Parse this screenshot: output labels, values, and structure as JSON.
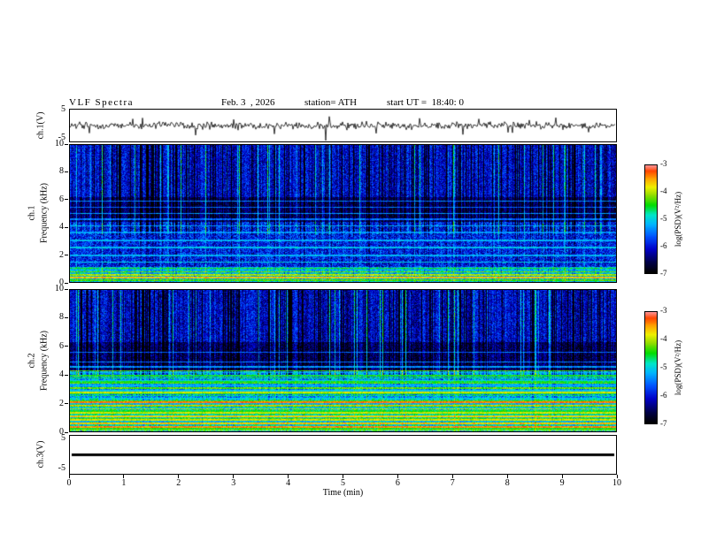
{
  "header": {
    "title": "VLF Spectra",
    "date": "Feb. 3  , 2026",
    "station": "station= ATH",
    "start_ut": "start UT =  18:40: 0"
  },
  "axes": {
    "x": {
      "label": "Time (min)",
      "ticks": [
        0,
        1,
        2,
        3,
        4,
        5,
        6,
        7,
        8,
        9,
        10
      ],
      "range": [
        0,
        10
      ]
    },
    "freq": {
      "ticks": [
        10,
        8,
        6,
        4,
        2,
        0
      ],
      "range": [
        0,
        10
      ]
    },
    "volt": {
      "top": "5",
      "bottom": "-5",
      "range": [
        -5,
        5
      ]
    }
  },
  "panels": {
    "ch1_wave": {
      "ylabel": "ch.1(V)"
    },
    "ch1_spec": {
      "ylabel_line1": "ch.1",
      "ylabel_line2": "Frequency (kHz)"
    },
    "ch2_spec": {
      "ylabel_line1": "ch.2",
      "ylabel_line2": "Frequency (kHz)"
    },
    "ch3_wave": {
      "ylabel": "ch.3(V)"
    }
  },
  "colorbar": {
    "label": "log(PSD)(V²/Hz)",
    "ticks": [
      -3,
      -4,
      -5,
      -6,
      -7
    ],
    "range": [
      -7,
      -3
    ],
    "stops": [
      {
        "t": 0.0,
        "c": "#000000"
      },
      {
        "t": 0.1,
        "c": "#00004a"
      },
      {
        "t": 0.22,
        "c": "#0000c8"
      },
      {
        "t": 0.34,
        "c": "#0055ff"
      },
      {
        "t": 0.45,
        "c": "#00b4ff"
      },
      {
        "t": 0.54,
        "c": "#00e6c8"
      },
      {
        "t": 0.63,
        "c": "#00dc00"
      },
      {
        "t": 0.72,
        "c": "#8cdc00"
      },
      {
        "t": 0.8,
        "c": "#f0f000"
      },
      {
        "t": 0.88,
        "c": "#ffa000"
      },
      {
        "t": 0.95,
        "c": "#ff4600"
      },
      {
        "t": 1.0,
        "c": "#ff9090"
      }
    ]
  },
  "chart_data": [
    {
      "type": "line",
      "name": "ch1-waveform",
      "ylabel": "ch.1(V)",
      "xlabel": "Time (min)",
      "xlim": [
        0,
        10
      ],
      "ylim": [
        -5,
        5
      ],
      "baseline": 0,
      "noise_amplitude": 0.7,
      "color": "#000000",
      "spikes": [
        {
          "x": 0.35,
          "v": -2.5
        },
        {
          "x": 1.15,
          "v": 2.2
        },
        {
          "x": 2.3,
          "v": -3.2
        },
        {
          "x": 3.0,
          "v": 2.0
        },
        {
          "x": 3.75,
          "v": -2.8
        },
        {
          "x": 4.68,
          "v": -5.0
        },
        {
          "x": 4.75,
          "v": 3.0
        },
        {
          "x": 5.6,
          "v": -2.6
        },
        {
          "x": 6.4,
          "v": 2.4
        },
        {
          "x": 7.2,
          "v": -3.0
        },
        {
          "x": 8.1,
          "v": -2.4
        },
        {
          "x": 8.9,
          "v": 2.6
        },
        {
          "x": 9.5,
          "v": -2.2
        }
      ]
    },
    {
      "type": "heatmap",
      "name": "ch1-spectrogram",
      "ylabel": "ch.1 Frequency (kHz)",
      "xlabel": "Time (min)",
      "xlim": [
        0,
        10
      ],
      "ylim": [
        0,
        10
      ],
      "value_range": [
        -7,
        -3
      ],
      "seed": 12345,
      "streaks": {
        "dark_prob": 0.2,
        "dark_depth": 1.1,
        "bright_prob": 0.08,
        "bright_boost": 1.2,
        "fmin": 3.5
      },
      "regions": [
        {
          "f": [
            6.2,
            10.01
          ],
          "base": -6.1,
          "noise": 0.45
        },
        {
          "f": [
            4.4,
            6.2
          ],
          "base": -6.55,
          "noise": 0.35
        },
        {
          "f": [
            1.1,
            4.4
          ],
          "base": -5.9,
          "noise": 0.55
        },
        {
          "f": [
            0,
            1.1
          ],
          "base": -5.1,
          "noise": 0.5
        }
      ],
      "harmonics": {
        "spacing": 0,
        "fmax": 0,
        "level": 0,
        "variation": 0
      },
      "hlines": [
        {
          "f": 5.9,
          "level": -5.4
        },
        {
          "f": 5.45,
          "level": -5.5
        },
        {
          "f": 5.0,
          "level": -5.3
        },
        {
          "f": 4.6,
          "level": -5.5
        },
        {
          "f": 4.1,
          "level": -5.2
        },
        {
          "f": 3.6,
          "level": -5.3
        },
        {
          "f": 3.05,
          "level": -5.2
        },
        {
          "f": 2.5,
          "level": -5.1
        },
        {
          "f": 1.95,
          "level": -5.2
        },
        {
          "f": 1.45,
          "level": -5.0
        },
        {
          "f": 1.0,
          "level": -4.5
        },
        {
          "f": 0.75,
          "level": -4.2
        },
        {
          "f": 0.5,
          "level": -4.0
        },
        {
          "f": 0.3,
          "level": -3.6
        },
        {
          "f": 0.12,
          "level": -4.3
        }
      ]
    },
    {
      "type": "heatmap",
      "name": "ch2-spectrogram",
      "ylabel": "ch.2 Frequency (kHz)",
      "xlabel": "Time (min)",
      "xlim": [
        0,
        10
      ],
      "ylim": [
        0,
        10
      ],
      "value_range": [
        -7,
        -3
      ],
      "seed": 98765,
      "streaks": {
        "dark_prob": 0.2,
        "dark_depth": 1.1,
        "bright_prob": 0.08,
        "bright_boost": 1.2,
        "fmin": 4.0
      },
      "regions": [
        {
          "f": [
            6.3,
            10.01
          ],
          "base": -6.1,
          "noise": 0.45
        },
        {
          "f": [
            4.3,
            6.3
          ],
          "base": -6.5,
          "noise": 0.4
        },
        {
          "f": [
            2.3,
            4.3
          ],
          "base": -5.3,
          "noise": 0.5
        },
        {
          "f": [
            0,
            2.3
          ],
          "base": -4.9,
          "noise": 0.5
        }
      ],
      "harmonics": {
        "spacing": 0.18,
        "fmax": 4.3,
        "level": -4.7,
        "variation": 0.5
      },
      "hlines": [
        {
          "f": 5.6,
          "level": -5.5
        },
        {
          "f": 4.9,
          "level": -5.4
        },
        {
          "f": 4.55,
          "level": -5.3
        },
        {
          "f": 3.9,
          "level": -4.4
        },
        {
          "f": 3.5,
          "level": -4.5
        },
        {
          "f": 3.1,
          "level": -4.3
        },
        {
          "f": 2.75,
          "level": -3.9
        },
        {
          "f": 2.05,
          "level": -3.3
        },
        {
          "f": 1.85,
          "level": -3.6
        },
        {
          "f": 1.6,
          "level": -4.0
        },
        {
          "f": 1.3,
          "level": -3.9
        },
        {
          "f": 1.05,
          "level": -3.7
        },
        {
          "f": 0.8,
          "level": -3.9
        },
        {
          "f": 0.55,
          "level": -3.6
        },
        {
          "f": 0.3,
          "level": -3.4
        },
        {
          "f": 0.1,
          "level": -4.0
        }
      ]
    },
    {
      "type": "line",
      "name": "ch3-waveform",
      "ylabel": "ch.3(V)",
      "xlabel": "Time (min)",
      "xlim": [
        0,
        10
      ],
      "ylim": [
        -5,
        5
      ],
      "baseline": 0,
      "noise_amplitude": 0,
      "thickness": 3,
      "color": "#000000",
      "spikes": []
    }
  ]
}
